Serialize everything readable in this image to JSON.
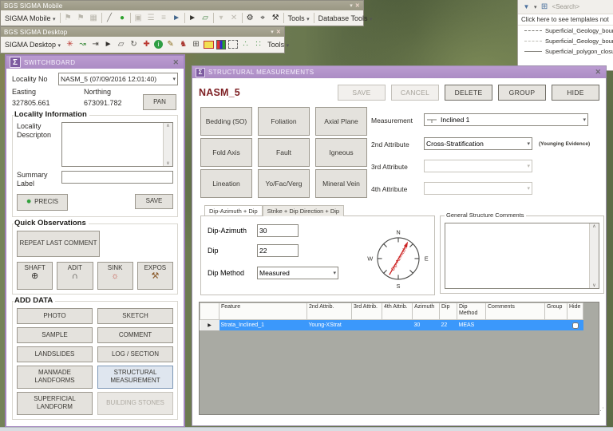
{
  "icons": {
    "sigma": "Σ",
    "close": "✕",
    "chevron": "▾",
    "flag": "⚑",
    "grid_sheet": "▦",
    "pencil_line": "╱",
    "gps_dot": "●",
    "panel": "▣",
    "list_rows": "☰",
    "stairs": "≡",
    "cursor_a": "►",
    "pointer": "►",
    "polygon": "▱",
    "small_chevron": "▾",
    "x_gray": "✕",
    "gear_sat": "⚙",
    "target_sat": "⌖",
    "hammer_sat": "⚒",
    "web_red": "✳",
    "bend_line": "↝",
    "merge": "⇥",
    "rotate": "↻",
    "plus_cross": "✚",
    "info_i": "i",
    "lock_pencil": "✎",
    "knight": "♞",
    "frame": "⊞",
    "dots3": "∴",
    "dots4": "∷",
    "funnel": "▼",
    "table_small": "⊞",
    "up": "∧",
    "down": "∨",
    "shaft": "⊕",
    "adit": "∩",
    "sink": "☼",
    "expos": "⚒",
    "dot_green": "●",
    "row_arrow": "▶"
  },
  "mobile_toolbar": {
    "title": "BGS SIGMA Mobile",
    "menu": "SIGMA Mobile",
    "tools": "Tools",
    "database_tools": "Database Tools"
  },
  "desktop_toolbar": {
    "title": "BGS SIGMA Desktop",
    "menu": "SIGMA Desktop",
    "tools": "Tools"
  },
  "templates_panel": {
    "search": "<Search>",
    "link": "Click here to see templates not",
    "items": [
      {
        "label": "Superficial_Geology_boundary"
      },
      {
        "label": "Superficial_Geology_boundary"
      },
      {
        "label": "Superficial_polygon_closure"
      }
    ]
  },
  "switchboard": {
    "title": "SWITCHBOARD",
    "locality_no_label": "Locality No",
    "locality_no_value": "NASM_5  (07/09/2016 12:01:40)",
    "easting_label": "Easting",
    "northing_label": "Northing",
    "easting_value": "327805.661",
    "northing_value": "673091.782",
    "pan_button": "PAN",
    "locality_information_title": "Locality Information",
    "locality_description_label": "Locality Descripton",
    "summary_label_label": "Summary Label",
    "precis_button": "PRECIS",
    "save_button": "SAVE",
    "quick_observations_title": "Quick Observations",
    "repeat_last_comment_button": "REPEAT LAST COMMENT",
    "shaft_button": "SHAFT",
    "adit_button": "ADIT",
    "sink_button": "SINK",
    "expos_button": "EXPOS",
    "add_data_title": "ADD DATA",
    "add_data_buttons": [
      "PHOTO",
      "SKETCH",
      "SAMPLE",
      "COMMENT",
      "LANDSLIDES",
      "LOG / SECTION",
      "MANMADE LANDFORMS",
      "STRUCTURAL MEASUREMENT",
      "SUPERFICIAL LANDFORM",
      "BUILDING STONES"
    ]
  },
  "structural_dialog": {
    "title": "STRUCTURAL MEASUREMENTS",
    "locality_id": "NASM_5",
    "actions": {
      "save": "SAVE",
      "cancel": "CANCEL",
      "delete": "DELETE",
      "group": "GROUP",
      "hide": "HIDE"
    },
    "feature_buttons": [
      "Bedding (SO)",
      "Foliation",
      "Axial Plane",
      "Fold Axis",
      "Fault",
      "Igneous",
      "Lineation",
      "Yo/Fac/Verg",
      "Mineral Vein"
    ],
    "measurement_label": "Measurement",
    "measurement_value": "Inclined 1",
    "attribute2_label": "2nd Attribute",
    "attribute2_value": "Cross-Stratification",
    "attribute2_note": "(Younging Evidence)",
    "attribute3_label": "3rd Attribute",
    "attribute4_label": "4th Attribute",
    "tabs": [
      "Dip-Azimuth + Dip",
      "Strike + Dip Direction + Dip"
    ],
    "dip_azimuth_label": "Dip-Azimuth",
    "dip_azimuth_value": "30",
    "dip_label": "Dip",
    "dip_value": "22",
    "dip_method_label": "Dip Method",
    "dip_method_value": "Measured",
    "compass": {
      "n": "N",
      "e": "E",
      "s": "S",
      "w": "W",
      "arrow_label": "Dip-Azimuth"
    },
    "comments_title": "General Structure Comments",
    "grid": {
      "columns": [
        "Feature",
        "2nd Attrib.",
        "3rd Attrib.",
        "4th Attrib.",
        "Azimuth",
        "Dip",
        "Dip Method",
        "Comments",
        "Group",
        "Hide"
      ],
      "row": {
        "feature": "Strata_Inclined_1",
        "attrib2": "Young-XStrat",
        "attrib3": "",
        "attrib4": "",
        "azimuth": "30",
        "dip": "22",
        "dip_method": "MEAS",
        "comments": "",
        "group": ""
      }
    }
  }
}
